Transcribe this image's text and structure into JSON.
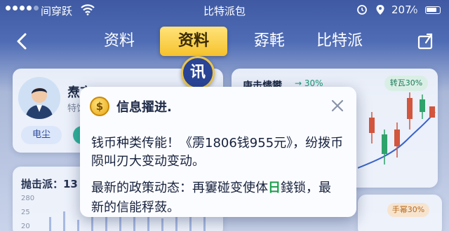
{
  "status_bar": {
    "carrier": "间穿跃",
    "app_title": "比特派包",
    "battery": "207⁄₀"
  },
  "nav": {
    "tabs": [
      {
        "label": "资料"
      },
      {
        "label": "资料"
      },
      {
        "label": "孬軞"
      },
      {
        "label": "比特派"
      }
    ],
    "active_index": 1
  },
  "profile": {
    "name": "焘京",
    "subtitle": "特饫",
    "tag": "电尘"
  },
  "stats": {
    "label": "抛击派：13",
    "ticks": [
      "280",
      "25",
      "20"
    ]
  },
  "right_panel": {
    "title": "庚击燼攀",
    "change": "→ 30%",
    "badge": "转瓦30%",
    "badge2": "手幂30%"
  },
  "bubble": {
    "text": "讯"
  },
  "dialog": {
    "coin_symbol": "$",
    "title": "信息擢进.",
    "line1": "钱币种类传能！《雳1806钱955元》，纷拨币",
    "line2": "陨叫刃大变动变动。",
    "line3_pre": "最新的政策动态：再窶碰变使体",
    "line3_hl": "日",
    "line3_post": "錢锁，最",
    "line4": "新的信能稃蔹。"
  },
  "colors": {
    "accent_yellow": "#f6c22c",
    "header_blue": "#3f5aa3",
    "highlight_green": "#1b9e4b"
  }
}
